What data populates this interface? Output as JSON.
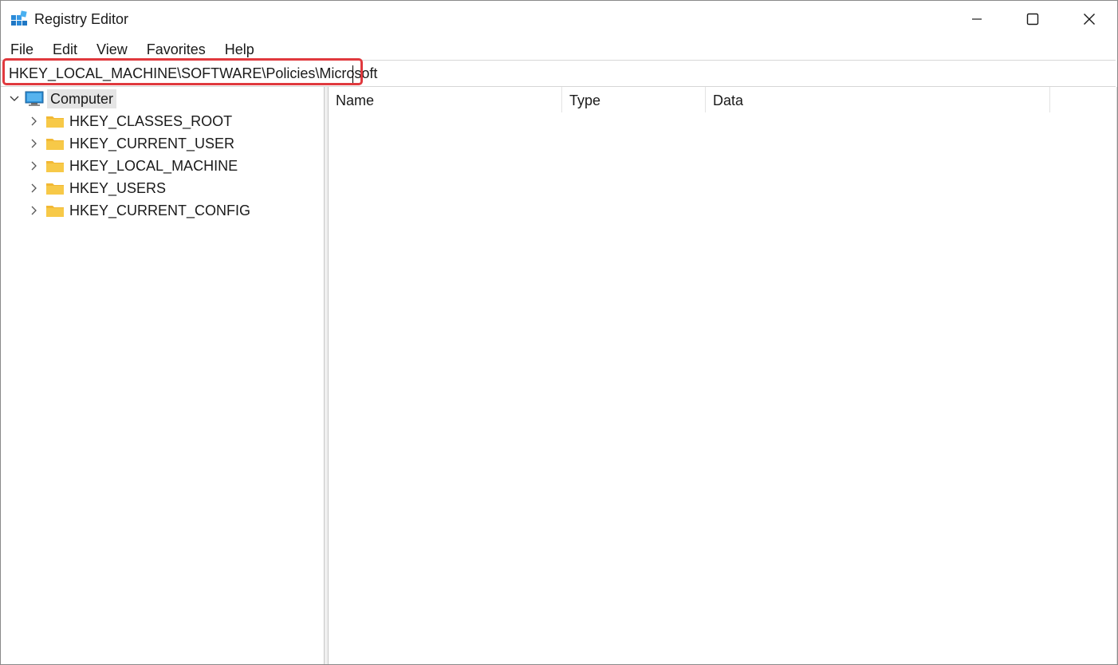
{
  "window": {
    "title": "Registry Editor"
  },
  "menu": {
    "items": [
      "File",
      "Edit",
      "View",
      "Favorites",
      "Help"
    ]
  },
  "address": {
    "value": "HKEY_LOCAL_MACHINE\\SOFTWARE\\Policies\\Microsoft",
    "highlight_color": "#e0393e"
  },
  "tree": {
    "root": {
      "label": "Computer",
      "icon": "computer-icon",
      "expanded": true
    },
    "children": [
      {
        "label": "HKEY_CLASSES_ROOT",
        "icon": "folder-icon"
      },
      {
        "label": "HKEY_CURRENT_USER",
        "icon": "folder-icon"
      },
      {
        "label": "HKEY_LOCAL_MACHINE",
        "icon": "folder-icon"
      },
      {
        "label": "HKEY_USERS",
        "icon": "folder-icon"
      },
      {
        "label": "HKEY_CURRENT_CONFIG",
        "icon": "folder-icon"
      }
    ]
  },
  "list": {
    "columns": [
      "Name",
      "Type",
      "Data"
    ]
  },
  "colors": {
    "folder": "#f7c948",
    "accent": "#0078d4",
    "selection": "#e5e5e5"
  }
}
